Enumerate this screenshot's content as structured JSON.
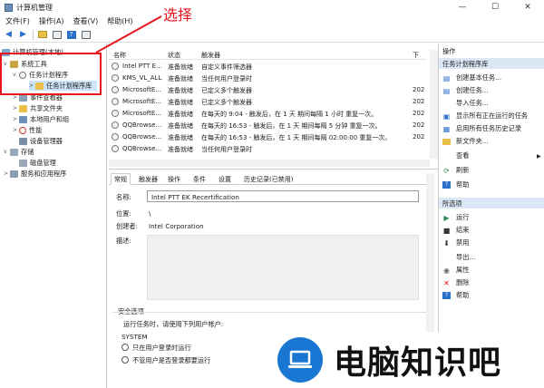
{
  "window": {
    "title": "计算机管理",
    "minimize": "—",
    "maximize": "☐",
    "close": "✕"
  },
  "menu": [
    "文件(F)",
    "操作(A)",
    "查看(V)",
    "帮助(H)"
  ],
  "annotation": {
    "label": "选择"
  },
  "tree": [
    {
      "label": "计算机管理(本地)",
      "level": 0
    },
    {
      "label": "系统工具",
      "level": 1
    },
    {
      "label": "任务计划程序",
      "level": 2
    },
    {
      "label": "任务计划程序库",
      "level": 3
    },
    {
      "label": "事件查看器",
      "level": 2
    },
    {
      "label": "共享文件夹",
      "level": 2
    },
    {
      "label": "本地用户和组",
      "level": 2
    },
    {
      "label": "性能",
      "level": 2
    },
    {
      "label": "设备管理器",
      "level": 2
    },
    {
      "label": "存储",
      "level": 1
    },
    {
      "label": "磁盘管理",
      "level": 2
    },
    {
      "label": "服务和应用程序",
      "level": 1
    }
  ],
  "task_list": {
    "columns": [
      "名称",
      "状态",
      "触发器",
      "下"
    ],
    "rows": [
      {
        "name": "Intel PTT E...",
        "status": "准备就绪",
        "trigger": "自定义事件筛选器",
        "next": ""
      },
      {
        "name": "KMS_VL_ALL",
        "status": "准备就绪",
        "trigger": "当任何用户登录时",
        "next": ""
      },
      {
        "name": "MicrosoftE...",
        "status": "准备就绪",
        "trigger": "已定义多个触发器",
        "next": "202"
      },
      {
        "name": "MicrosoftE...",
        "status": "准备就绪",
        "trigger": "已定义多个触发器",
        "next": "202"
      },
      {
        "name": "MicrosoftE...",
        "status": "准备就绪",
        "trigger": "在每天的 9:04 - 触发后，在 1 天 期间每隔 1 小时 重复一次。",
        "next": "202"
      },
      {
        "name": "QQBrowse...",
        "status": "准备就绪",
        "trigger": "在每天的 16:53 - 触发后，在 1 天 期间每隔 5 分钟 重复一次。",
        "next": "202"
      },
      {
        "name": "QQBrowse...",
        "status": "准备就绪",
        "trigger": "在每天的 16:53 - 触发后，在 1 天 期间每隔 02:00:00 重复一次。",
        "next": "202"
      },
      {
        "name": "QQBrowse...",
        "status": "准备就绪",
        "trigger": "当任何用户登录时",
        "next": ""
      }
    ]
  },
  "details": {
    "tabs": [
      "常规",
      "触发器",
      "操作",
      "条件",
      "设置",
      "历史记录(已禁用)"
    ],
    "name_label": "名称:",
    "name_value": "Intel PTT EK Recertification",
    "location_label": "位置:",
    "location_value": "\\",
    "author_label": "创建者:",
    "author_value": "Intel Corporation",
    "desc_label": "描述:",
    "security_label": "安全选项",
    "run_as_label": "运行任务时，请使用下列用户帐户:",
    "run_as_value": "SYSTEM",
    "radio_logged_on": "只在用户登录时运行",
    "radio_whether": "不管用户是否登录都要运行"
  },
  "actions": {
    "header": "操作",
    "group1_title": "任务计划程序库",
    "group1": [
      {
        "icon": "create-basic-task-icon",
        "label": "创建基本任务..."
      },
      {
        "icon": "create-task-icon",
        "label": "创建任务..."
      },
      {
        "icon": "import-icon",
        "label": "导入任务..."
      },
      {
        "icon": "running-tasks-icon",
        "label": "显示所有正在运行的任务"
      },
      {
        "icon": "history-icon",
        "label": "启用所有任务历史记录"
      },
      {
        "icon": "new-folder-icon",
        "label": "新文件夹..."
      },
      {
        "icon": "view-icon",
        "label": "查看"
      },
      {
        "icon": "refresh-icon",
        "label": "刷新"
      },
      {
        "icon": "help-icon",
        "label": "帮助"
      }
    ],
    "group2_title": "所选项",
    "group2": [
      {
        "icon": "run-icon",
        "label": "运行"
      },
      {
        "icon": "end-icon",
        "label": "结束"
      },
      {
        "icon": "disable-icon",
        "label": "禁用"
      },
      {
        "icon": "export-icon",
        "label": "导出..."
      },
      {
        "icon": "properties-icon",
        "label": "属性"
      },
      {
        "icon": "delete-icon",
        "label": "删除"
      },
      {
        "icon": "help-icon",
        "label": "帮助"
      }
    ]
  },
  "watermark": {
    "text": "电脑知识吧"
  },
  "colors": {
    "accent": "#1976d2",
    "highlight": "#e8141c",
    "selection": "#cce4f7"
  }
}
